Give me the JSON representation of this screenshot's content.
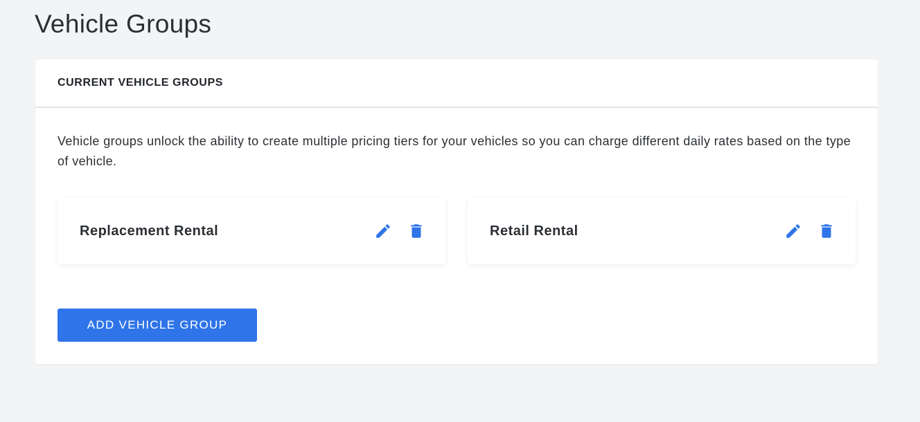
{
  "page": {
    "title": "Vehicle Groups"
  },
  "card": {
    "header_title": "CURRENT VEHICLE GROUPS",
    "description": "Vehicle groups unlock the ability to create multiple pricing tiers for your vehicles so you can charge different daily rates based on the type of vehicle."
  },
  "groups": [
    {
      "name": "Replacement Rental",
      "edit_icon": "pencil-icon",
      "delete_icon": "trash-icon"
    },
    {
      "name": "Retail Rental",
      "edit_icon": "pencil-icon",
      "delete_icon": "trash-icon"
    }
  ],
  "actions": {
    "add_label": "ADD VEHICLE GROUP"
  },
  "colors": {
    "accent": "#2f74e8",
    "background": "#f3f4f6",
    "card": "#ffffff"
  }
}
